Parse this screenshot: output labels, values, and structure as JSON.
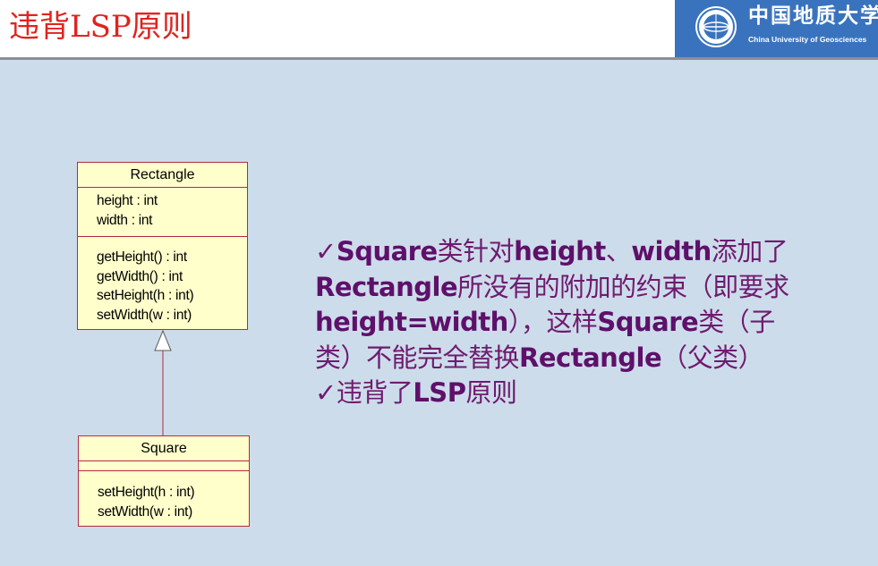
{
  "slide": {
    "title": "违背LSP原则"
  },
  "logo": {
    "name_cn": "中国地质大学",
    "name_en": "China University of Geosciences"
  },
  "uml": {
    "rectangle": {
      "name": "Rectangle",
      "attributes": [
        "height : int",
        "width : int"
      ],
      "operations": [
        "getHeight() : int",
        "getWidth() : int",
        "setHeight(h : int)",
        "setWidth(w : int)"
      ]
    },
    "square": {
      "name": "Square",
      "attributes": [],
      "operations": [
        "setHeight(h : int)",
        "setWidth(w : int)"
      ]
    },
    "relation": "generalization"
  },
  "explanation": {
    "check": "✓",
    "l1_t1": "Square",
    "l1_t2": "类针对",
    "l1_t3": "height",
    "l1_t4": "、",
    "l1_t5": "width",
    "l1_t6": "添加了",
    "l2_t1": "Rectangle",
    "l2_t2": "所没有的附加的约束（即要求",
    "l3_t1": "height=width",
    "l3_t2": "），这样",
    "l3_t3": "Square",
    "l3_t4": "类（子",
    "l4_t1": "类）不能完全替换",
    "l4_t2": "Rectangle",
    "l4_t3": "（父类）",
    "l5_t1": "违背了",
    "l5_t2": "LSP",
    "l5_t3": "原则"
  },
  "colors": {
    "background": "#cddceb",
    "title": "#e0231f",
    "text": "#6f1b6f",
    "uml_fill": "#ffffcc",
    "uml_border": "#b32a44",
    "logo_bg": "#3a73bd"
  }
}
